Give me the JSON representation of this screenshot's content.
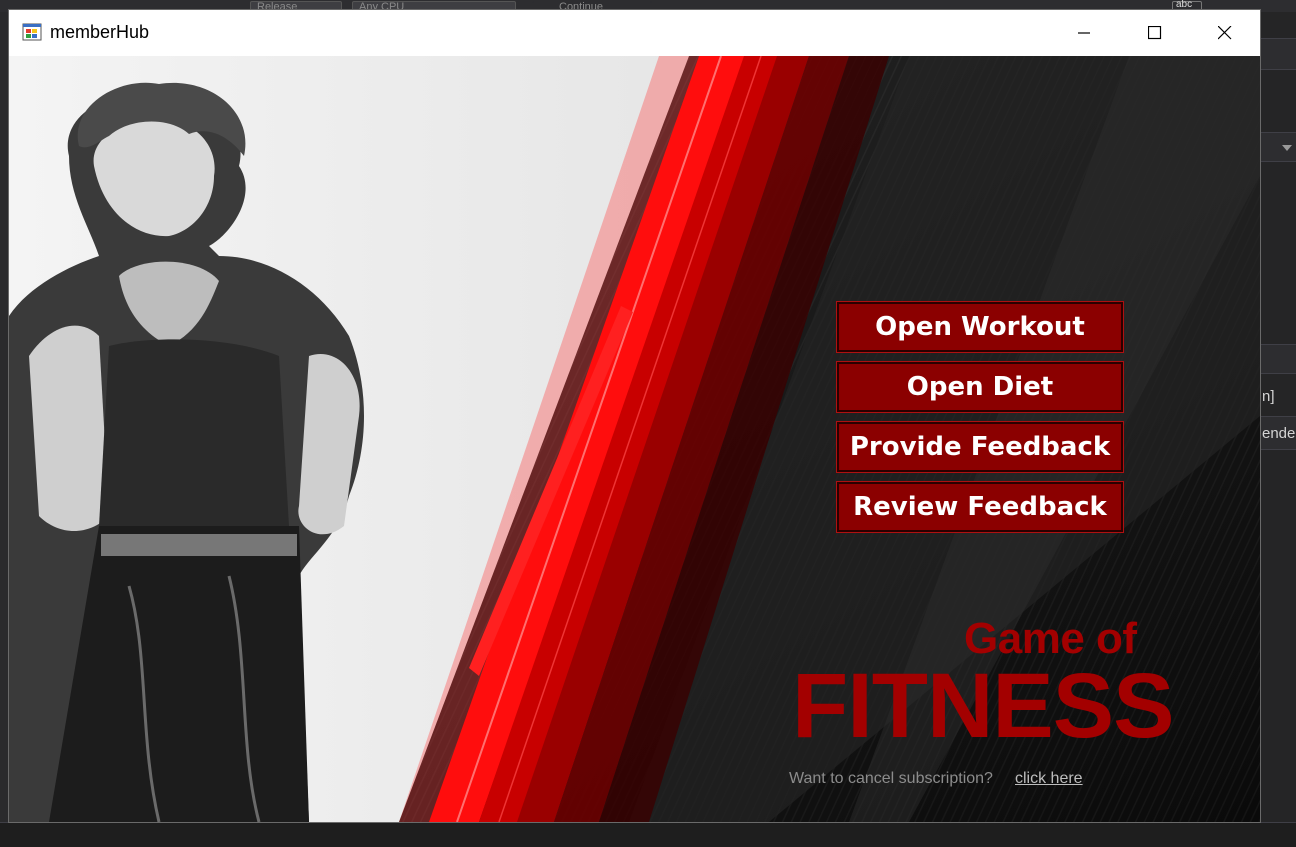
{
  "ide": {
    "toolbar_items": [
      "Release",
      "Any CPU",
      "Continue"
    ],
    "right_fragments": [
      "n]",
      "ender"
    ],
    "right_abc": "abc"
  },
  "window": {
    "title": "memberHub",
    "icon": "winforms-app-icon",
    "controls": [
      "minimize-icon",
      "maximize-icon",
      "close-icon"
    ]
  },
  "menu": {
    "open_workout": "Open Workout",
    "open_diet": "Open Diet",
    "provide_feedback": "Provide Feedback",
    "review_feedback": "Review Feedback"
  },
  "brand": {
    "line1": "Game of",
    "line2": "FITNESS"
  },
  "footer": {
    "cancel_prompt": "Want to cancel subscription?",
    "cancel_link": "click here"
  },
  "colors": {
    "button_bg": "#8b0000",
    "brand_red": "#a30000",
    "accent_red": "#e00000"
  }
}
